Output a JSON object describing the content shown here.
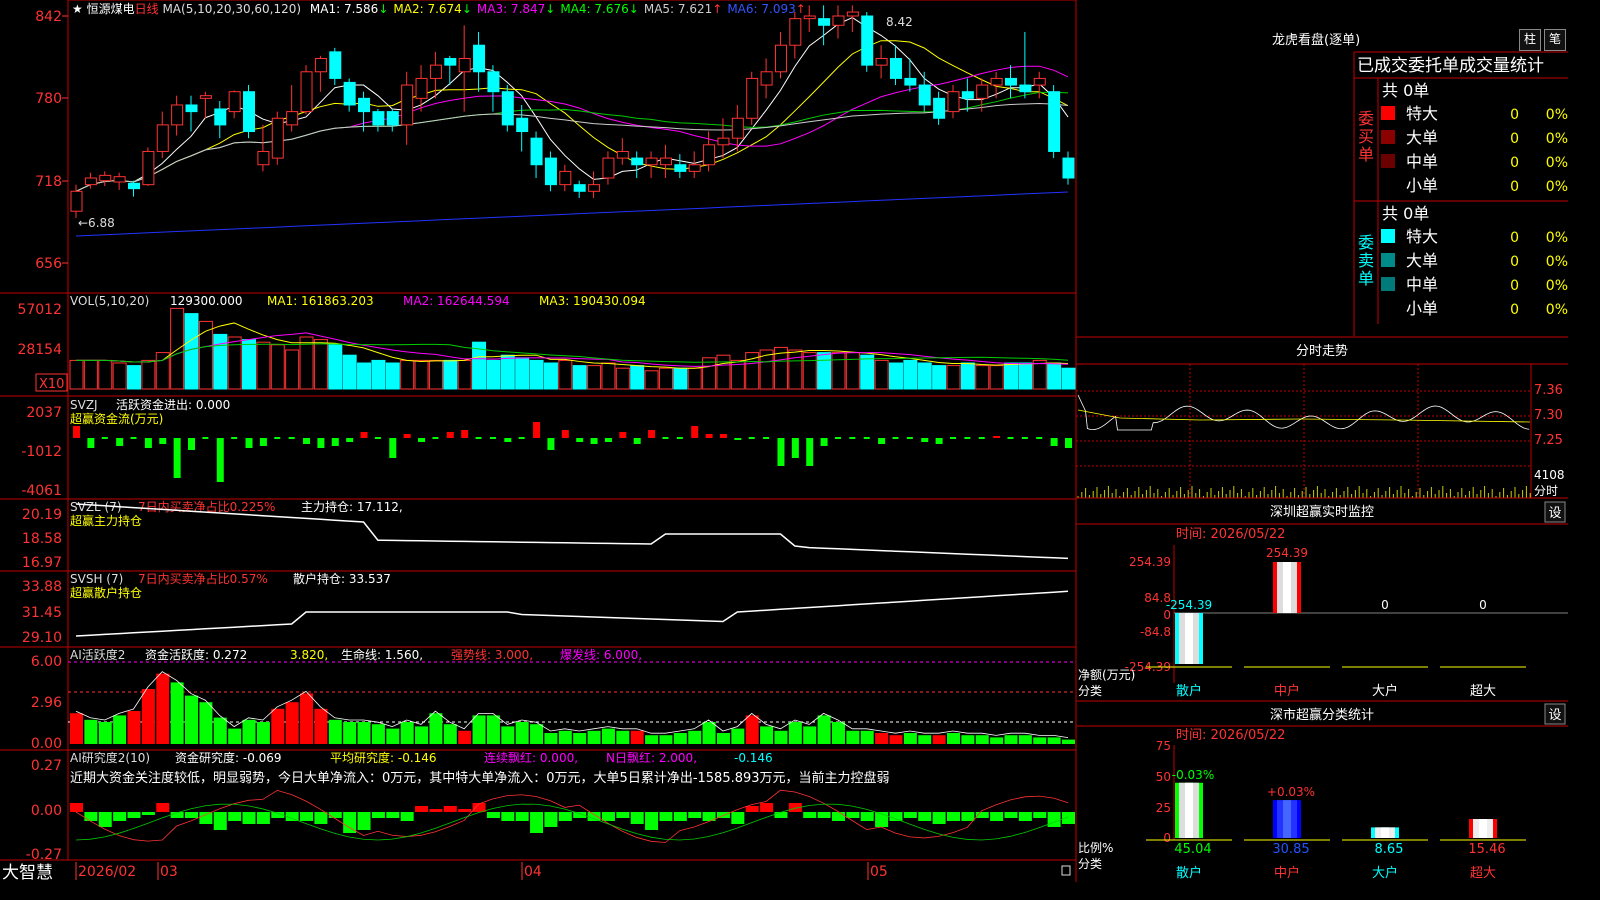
{
  "header": {
    "star": "★",
    "stock_name": "恒源煤电",
    "period": "日线",
    "ma_settings": "MA(5,10,20,30,60,120)",
    "mas": [
      {
        "label": "MA1:",
        "value": "7.586",
        "arrow": "↓",
        "color": "#ffffff"
      },
      {
        "label": "MA2:",
        "value": "7.674",
        "arrow": "↓",
        "color": "#ffff00"
      },
      {
        "label": "MA3:",
        "value": "7.847",
        "arrow": "↓",
        "color": "#ff00ff"
      },
      {
        "label": "MA4:",
        "value": "7.676",
        "arrow": "↓",
        "color": "#00ff00"
      },
      {
        "label": "MA5:",
        "value": "7.621",
        "arrow": "↑",
        "color": "#cccccc"
      },
      {
        "label": "MA6:",
        "value": "7.093",
        "arrow": "↑",
        "color": "#3355ff"
      }
    ]
  },
  "main_axis": {
    "ticks": [
      "842",
      "780",
      "718",
      "656"
    ],
    "high_label": "8.42",
    "low_label": "6.88"
  },
  "volume": {
    "title": "VOL(5,10,20)",
    "value": "129300.000",
    "ma1": "MA1: 161863.203",
    "ma2": "MA2: 162644.594",
    "ma3": "MA3: 190430.094",
    "ticks": [
      "57012",
      "28154"
    ],
    "unit": "X10"
  },
  "svzj": {
    "title": "SVZJ",
    "line": "活跃资金进出: 0.000",
    "subtitle": "超赢资金流(万元)",
    "ticks": [
      "2037",
      "-1012",
      "-4061"
    ]
  },
  "svzl": {
    "title": "SVZL (7)",
    "line": "7日内买卖净占比0.225%",
    "hold": "主力持仓: 17.112,",
    "subtitle": "超赢主力持仓",
    "ticks": [
      "20.19",
      "18.58",
      "16.97"
    ]
  },
  "svsh": {
    "title": "SVSH (7)",
    "line": "7日内买卖净占比0.57%",
    "hold": "散户持仓: 33.537",
    "subtitle": "超赢散户持仓",
    "ticks": [
      "33.88",
      "31.45",
      "29.10"
    ]
  },
  "ai_active": {
    "title": "AI活跃度2",
    "a": "资金活跃度: 0.272",
    "b": "3.820,",
    "c": "生命线: 1.560,",
    "d": "强势线: 3.000,",
    "e": "爆发线: 6.000,",
    "ticks": [
      "6.00",
      "2.96",
      "0.00"
    ]
  },
  "ai_research": {
    "title": "AI研究度2(10)",
    "a": "资金研究度: -0.069",
    "b": "平均研究度: -0.146",
    "c": "连续飘红: 0.000,",
    "d": "N日飘红: 2.000,",
    "e": "-0.146",
    "summary": "近期大资金关注度较低，明显弱势，今日大单净流入：0万元，其中特大单净流入：0万元，大单5日累计净出-1585.893万元，当前主力控盘弱",
    "ticks": [
      "0.27",
      "0.00",
      "-0.27"
    ]
  },
  "footer": {
    "brand": "大智慧",
    "dates": [
      "2026/02",
      "03",
      "04",
      "05"
    ]
  },
  "right": {
    "lhkp_title": "龙虎看盘(逐单)",
    "btn_zhu": "柱",
    "btn_bi": "笔",
    "stats_title": "已成交委托单成交量统计",
    "buy_label": "委买单",
    "sell_label": "委卖单",
    "buy_total": "共 0单",
    "sell_total": "共 0单",
    "buy_rows": [
      {
        "name": "特大",
        "count": "0",
        "pct": "0%",
        "color": "#ff0000"
      },
      {
        "name": "大单",
        "count": "0",
        "pct": "0%",
        "color": "#8b0000"
      },
      {
        "name": "中单",
        "count": "0",
        "pct": "0%",
        "color": "#6b0000"
      },
      {
        "name": "小单",
        "count": "0",
        "pct": "0%",
        "color": ""
      }
    ],
    "sell_rows": [
      {
        "name": "特大",
        "count": "0",
        "pct": "0%",
        "color": "#00ffff"
      },
      {
        "name": "大单",
        "count": "0",
        "pct": "0%",
        "color": "#008b8b"
      },
      {
        "name": "中单",
        "count": "0",
        "pct": "0%",
        "color": "#007a7a"
      },
      {
        "name": "小单",
        "count": "0",
        "pct": "0%",
        "color": ""
      }
    ],
    "fenshi_title": "分时走势",
    "fenshi_ticks": [
      "7.36",
      "7.30",
      "7.25"
    ],
    "fenshi_vol": "4108",
    "fenshi_unit": "分时",
    "sz_monitor_title": "深圳超赢实时监控",
    "sz_set": "设",
    "sz_time": "时间: 2026/05/22",
    "sz_ticks": [
      "254.39",
      "84.8",
      "0",
      "-84.8",
      "-254.39"
    ],
    "sz_unit": "净额(万元)",
    "sz_cat": "分类",
    "sz_values": [
      {
        "cat": "散户",
        "value": -254.39,
        "label": "-254.39"
      },
      {
        "cat": "中户",
        "value": 254.39,
        "label": "254.39"
      },
      {
        "cat": "大户",
        "value": 0,
        "label": "0"
      },
      {
        "cat": "超大",
        "value": 0,
        "label": "0"
      }
    ],
    "cls_title": "深市超赢分类统计",
    "cls_set": "设",
    "cls_time": "时间: 2026/05/22",
    "cls_ticks": [
      "75",
      "50",
      "25",
      "0"
    ],
    "cls_unit": "比例%",
    "cls_cat": "分类",
    "cls_values": [
      {
        "cat": "散户",
        "value": 45.04,
        "label": "45.04",
        "delta": "-0.03%"
      },
      {
        "cat": "中户",
        "value": 30.85,
        "label": "30.85",
        "delta": "+0.03%"
      },
      {
        "cat": "大户",
        "value": 8.65,
        "label": "8.65",
        "delta": ""
      },
      {
        "cat": "超大",
        "value": 15.46,
        "label": "15.46",
        "delta": ""
      }
    ]
  },
  "chart_data": {
    "type": "candlestick",
    "y_range": [
      6.56,
      8.42
    ],
    "candles": [
      [
        6.95,
        7.1,
        6.9,
        7.15
      ],
      [
        7.15,
        7.2,
        7.12,
        7.24
      ],
      [
        7.18,
        7.22,
        7.14,
        7.25
      ],
      [
        7.17,
        7.21,
        7.11,
        7.24
      ],
      [
        7.16,
        7.12,
        7.06,
        7.18
      ],
      [
        7.15,
        7.4,
        7.14,
        7.43
      ],
      [
        7.4,
        7.6,
        7.35,
        7.7
      ],
      [
        7.6,
        7.75,
        7.52,
        7.82
      ],
      [
        7.75,
        7.7,
        7.55,
        7.82
      ],
      [
        7.8,
        7.82,
        7.65,
        7.85
      ],
      [
        7.72,
        7.6,
        7.5,
        7.78
      ],
      [
        7.7,
        7.85,
        7.65,
        7.86
      ],
      [
        7.85,
        7.55,
        7.5,
        7.9
      ],
      [
        7.3,
        7.4,
        7.25,
        7.6
      ],
      [
        7.35,
        7.65,
        7.3,
        7.7
      ],
      [
        7.6,
        7.7,
        7.55,
        7.9
      ],
      [
        7.7,
        8.0,
        7.68,
        8.05
      ],
      [
        8.0,
        8.1,
        7.85,
        8.12
      ],
      [
        8.15,
        7.95,
        7.9,
        8.18
      ],
      [
        7.92,
        7.75,
        7.7,
        7.95
      ],
      [
        7.8,
        7.7,
        7.55,
        7.85
      ],
      [
        7.7,
        7.6,
        7.55,
        7.72
      ],
      [
        7.7,
        7.6,
        7.55,
        7.72
      ],
      [
        7.6,
        7.9,
        7.45,
        8.0
      ],
      [
        7.8,
        7.95,
        7.7,
        8.05
      ],
      [
        7.95,
        8.05,
        7.8,
        8.15
      ],
      [
        8.1,
        8.05,
        7.9,
        8.12
      ],
      [
        8.0,
        8.1,
        7.7,
        8.35
      ],
      [
        8.2,
        8.0,
        7.85,
        8.3
      ],
      [
        8.0,
        7.85,
        7.7,
        8.05
      ],
      [
        7.85,
        7.6,
        7.55,
        7.9
      ],
      [
        7.65,
        7.55,
        7.4,
        7.75
      ],
      [
        7.5,
        7.3,
        7.2,
        7.55
      ],
      [
        7.35,
        7.15,
        7.1,
        7.4
      ],
      [
        7.15,
        7.25,
        7.1,
        7.3
      ],
      [
        7.15,
        7.1,
        7.05,
        7.18
      ],
      [
        7.1,
        7.15,
        7.05,
        7.25
      ],
      [
        7.2,
        7.35,
        7.15,
        7.4
      ],
      [
        7.35,
        7.4,
        7.3,
        7.5
      ],
      [
        7.35,
        7.3,
        7.2,
        7.4
      ],
      [
        7.3,
        7.35,
        7.2,
        7.4
      ],
      [
        7.3,
        7.35,
        7.2,
        7.45
      ],
      [
        7.3,
        7.25,
        7.2,
        7.38
      ],
      [
        7.25,
        7.3,
        7.2,
        7.4
      ],
      [
        7.3,
        7.45,
        7.25,
        7.55
      ],
      [
        7.45,
        7.5,
        7.35,
        7.65
      ],
      [
        7.5,
        7.65,
        7.4,
        7.75
      ],
      [
        7.65,
        7.95,
        7.6,
        8.0
      ],
      [
        7.9,
        8.0,
        7.8,
        8.1
      ],
      [
        8.0,
        8.2,
        7.95,
        8.3
      ],
      [
        8.2,
        8.4,
        8.1,
        8.45
      ],
      [
        8.4,
        8.42,
        8.3,
        8.5
      ],
      [
        8.4,
        8.35,
        8.2,
        8.5
      ],
      [
        8.35,
        8.42,
        8.25,
        8.5
      ],
      [
        8.42,
        8.45,
        8.3,
        8.5
      ],
      [
        8.42,
        8.05,
        8.0,
        8.45
      ],
      [
        8.05,
        8.1,
        7.95,
        8.2
      ],
      [
        8.1,
        7.95,
        7.9,
        8.2
      ],
      [
        7.95,
        7.9,
        7.85,
        8.1
      ],
      [
        7.9,
        7.75,
        7.7,
        8.0
      ],
      [
        7.8,
        7.65,
        7.6,
        7.85
      ],
      [
        7.7,
        7.85,
        7.65,
        7.9
      ],
      [
        7.85,
        7.8,
        7.7,
        7.95
      ],
      [
        7.8,
        7.9,
        7.7,
        7.95
      ],
      [
        7.9,
        7.95,
        7.8,
        8.0
      ],
      [
        7.95,
        7.9,
        7.8,
        8.05
      ],
      [
        7.9,
        7.85,
        7.8,
        8.3
      ],
      [
        7.9,
        7.95,
        7.8,
        8.0
      ],
      [
        7.85,
        7.4,
        7.35,
        7.9
      ],
      [
        7.35,
        7.2,
        7.15,
        7.4
      ]
    ]
  }
}
